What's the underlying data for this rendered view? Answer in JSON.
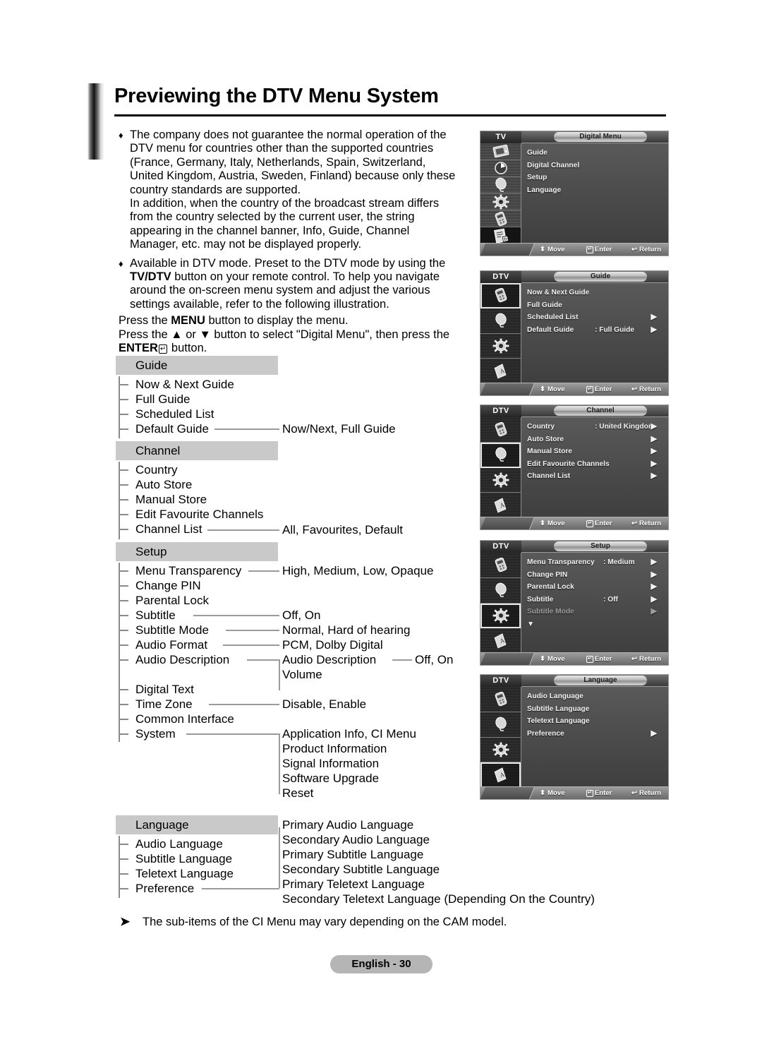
{
  "page": {
    "title": "Previewing the DTV Menu System",
    "footer_label": "English - 30",
    "note": {
      "marker": "➤",
      "text": "The sub-items of the CI Menu may vary depending on the CAM model."
    }
  },
  "intro": {
    "bullet1": {
      "marker": "♦",
      "line1": "The company does not guarantee the normal operation of the",
      "line2": "DTV menu for countries other than the supported countries",
      "line3": "(France, Germany, Italy, Netherlands, Spain, Switzerland,",
      "line4": "United Kingdom, Austria, Sweden, Finland) because only these",
      "line5": "country standards are supported.",
      "line6": "In addition, when the country of the broadcast stream differs",
      "line7": "from the country selected by the current user, the string",
      "line8": "appearing in the channel banner, Info, Guide, Channel",
      "line9": "Manager, etc. may not be displayed properly."
    },
    "bullet2": {
      "marker": "♦",
      "line1_a": "Available in DTV mode. Preset to the DTV mode by using the",
      "line2_bold": "TV/DTV",
      "line2_rest": " button on your remote control. To help you navigate",
      "line3": "around the on-screen menu system and adjust the various",
      "line4": "settings available, refer to the following illustration."
    },
    "instructions": {
      "line1_pre": "Press the ",
      "line1_bold": "MENU",
      "line1_post": " button to display the menu.",
      "line2_pre": "Press the ",
      "line2_updown": "▲ or ▼",
      "line2_post": " button to select \"Digital Menu\", then press the",
      "line3_bold": "ENTER",
      "line3_glyph": "↵",
      "line3_post": " button."
    }
  },
  "tree": {
    "groups": [
      {
        "header": "Guide",
        "items": [
          "Now & Next Guide",
          "Full Guide",
          "Scheduled List",
          "Default Guide"
        ],
        "values": {
          "Default Guide": "Now/Next, Full Guide"
        }
      },
      {
        "header": "Channel",
        "items": [
          "Country",
          "Auto Store",
          "Manual Store",
          "Edit Favourite Channels",
          "Channel List"
        ],
        "values": {
          "Channel List": "All, Favourites, Default"
        }
      },
      {
        "header": "Setup",
        "items": [
          "Menu Transparency",
          "Change PIN",
          "Parental Lock",
          "Subtitle",
          "Subtitle Mode",
          "Audio Format",
          "Audio Description",
          "Digital Text",
          "Time Zone",
          "Common Interface",
          "System"
        ],
        "values": {
          "Menu Transparency": "High, Medium, Low, Opaque",
          "Subtitle": "Off, On",
          "Subtitle Mode": "Normal, Hard of hearing",
          "Audio Format": "PCM, Dolby Digital",
          "Digital Text": "Disable, Enable",
          "Common Interface": "Application Info, CI Menu"
        },
        "audio_description_sub": [
          "Audio Description",
          "Volume"
        ],
        "audio_description_sub_value": "Off, On",
        "system_sub": [
          "Product Information",
          "Signal Information",
          "Software Upgrade",
          "Reset"
        ]
      },
      {
        "header": "Language",
        "items": [
          "Audio Language",
          "Subtitle Language",
          "Teletext Language",
          "Preference"
        ],
        "preference_sub": [
          "Primary Audio Language",
          "Secondary Audio Language",
          "Primary Subtitle Language",
          "Secondary Subtitle Language",
          "Primary Teletext Language",
          "Secondary Teletext Language (Depending On the Country)"
        ]
      }
    ]
  },
  "osd_hints": {
    "move": "Move",
    "enter": "Enter",
    "return": "Return"
  },
  "osd_screens": [
    {
      "mode": "TV",
      "title": "Digital Menu",
      "icon_count": 6,
      "selected_index": 5,
      "rows": [
        {
          "label": "Guide",
          "value": "",
          "arrow": false
        },
        {
          "label": "Digital Channel",
          "value": "",
          "arrow": false
        },
        {
          "label": "Setup",
          "value": "",
          "arrow": false
        },
        {
          "label": "Language",
          "value": "",
          "arrow": false
        }
      ]
    },
    {
      "mode": "DTV",
      "title": "Guide",
      "icon_count": 4,
      "selected_index": 0,
      "rows": [
        {
          "label": "Now & Next Guide",
          "value": "",
          "arrow": false
        },
        {
          "label": "Full Guide",
          "value": "",
          "arrow": false
        },
        {
          "label": "Scheduled List",
          "value": "",
          "arrow": true
        },
        {
          "label": "Default Guide",
          "value": ": Full Guide",
          "arrow": true
        }
      ]
    },
    {
      "mode": "DTV",
      "title": "Channel",
      "icon_count": 4,
      "selected_index": 1,
      "rows": [
        {
          "label": "Country",
          "value": ": United Kingdom",
          "arrow": true
        },
        {
          "label": "Auto Store",
          "value": "",
          "arrow": true
        },
        {
          "label": "Manual Store",
          "value": "",
          "arrow": true
        },
        {
          "label": "Edit Favourite Channels",
          "value": "",
          "arrow": true
        },
        {
          "label": "Channel List",
          "value": "",
          "arrow": true
        }
      ]
    },
    {
      "mode": "DTV",
      "title": "Setup",
      "icon_count": 4,
      "selected_index": 2,
      "rows": [
        {
          "label": "Menu Transparency",
          "value": ": Medium",
          "arrow": true
        },
        {
          "label": "Change PIN",
          "value": "",
          "arrow": true
        },
        {
          "label": "Parental Lock",
          "value": "",
          "arrow": true
        },
        {
          "label": "Subtitle",
          "value": ": Off",
          "arrow": true
        },
        {
          "label": "Subtitle  Mode",
          "value": "",
          "arrow": true,
          "dim": true
        },
        {
          "label": "▼",
          "value": "",
          "arrow": false
        }
      ]
    },
    {
      "mode": "DTV",
      "title": "Language",
      "icon_count": 4,
      "selected_index": 3,
      "rows": [
        {
          "label": "Audio Language",
          "value": "",
          "arrow": false
        },
        {
          "label": "Subtitle Language",
          "value": "",
          "arrow": false
        },
        {
          "label": "Teletext Language",
          "value": "",
          "arrow": false
        },
        {
          "label": "Preference",
          "value": "",
          "arrow": true
        }
      ]
    }
  ]
}
